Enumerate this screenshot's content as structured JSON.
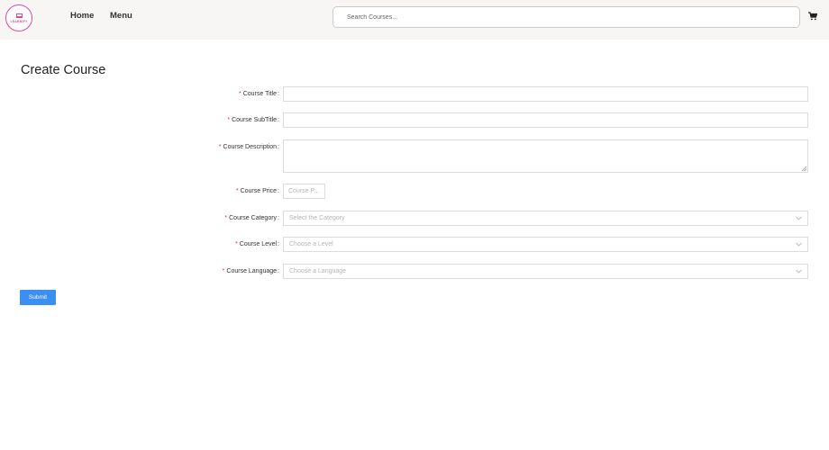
{
  "navbar": {
    "logo_text": "LEARNIFY",
    "links": [
      {
        "label": "Home"
      },
      {
        "label": "Menu"
      }
    ],
    "search": {
      "placeholder": "Search Courses..."
    },
    "cart_icon": "shopping-cart-icon"
  },
  "page": {
    "title": "Create Course"
  },
  "form": {
    "required_mark": "*",
    "colon": ":",
    "title": {
      "label": "Course Title",
      "value": ""
    },
    "subtitle": {
      "label": "Course SubTitle",
      "value": ""
    },
    "description": {
      "label": "Course Description",
      "value": ""
    },
    "price": {
      "label": "Course Price",
      "placeholder": "Course P..."
    },
    "category": {
      "label": "Course Category",
      "placeholder": "Select the Category"
    },
    "level": {
      "label": "Course Level",
      "placeholder": "Choose a Level"
    },
    "language": {
      "label": "Course Language",
      "placeholder": "Choose a Language"
    },
    "submit_label": "Submit"
  },
  "colors": {
    "accent": "#3b8ff1",
    "brand": "#e0489a",
    "required": "#e0333a",
    "navbar_bg": "#f7f6f5"
  }
}
